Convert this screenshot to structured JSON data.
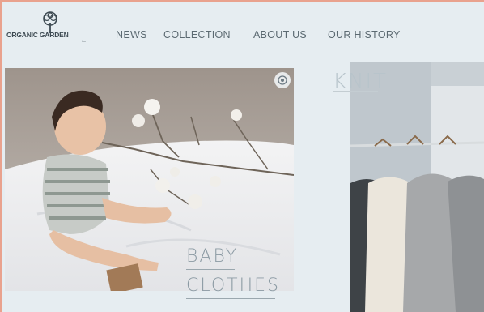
{
  "header": {
    "logo": {
      "text": "ORGANIC GARDEN",
      "sub": "inc"
    },
    "nav": [
      {
        "label": "NEWS"
      },
      {
        "label": "COLLECTION"
      },
      {
        "label": "ABOUT US"
      },
      {
        "label": "OUR HISTORY"
      }
    ]
  },
  "featured": [
    {
      "label_line1": "BABY",
      "label_line2": "CLOTHES",
      "icon": "zoom-icon"
    },
    {
      "label": "KNIT"
    }
  ],
  "colors": {
    "frame_border": "#e9a28e",
    "background": "#e6edf1",
    "nav_text": "#5c6a72"
  }
}
